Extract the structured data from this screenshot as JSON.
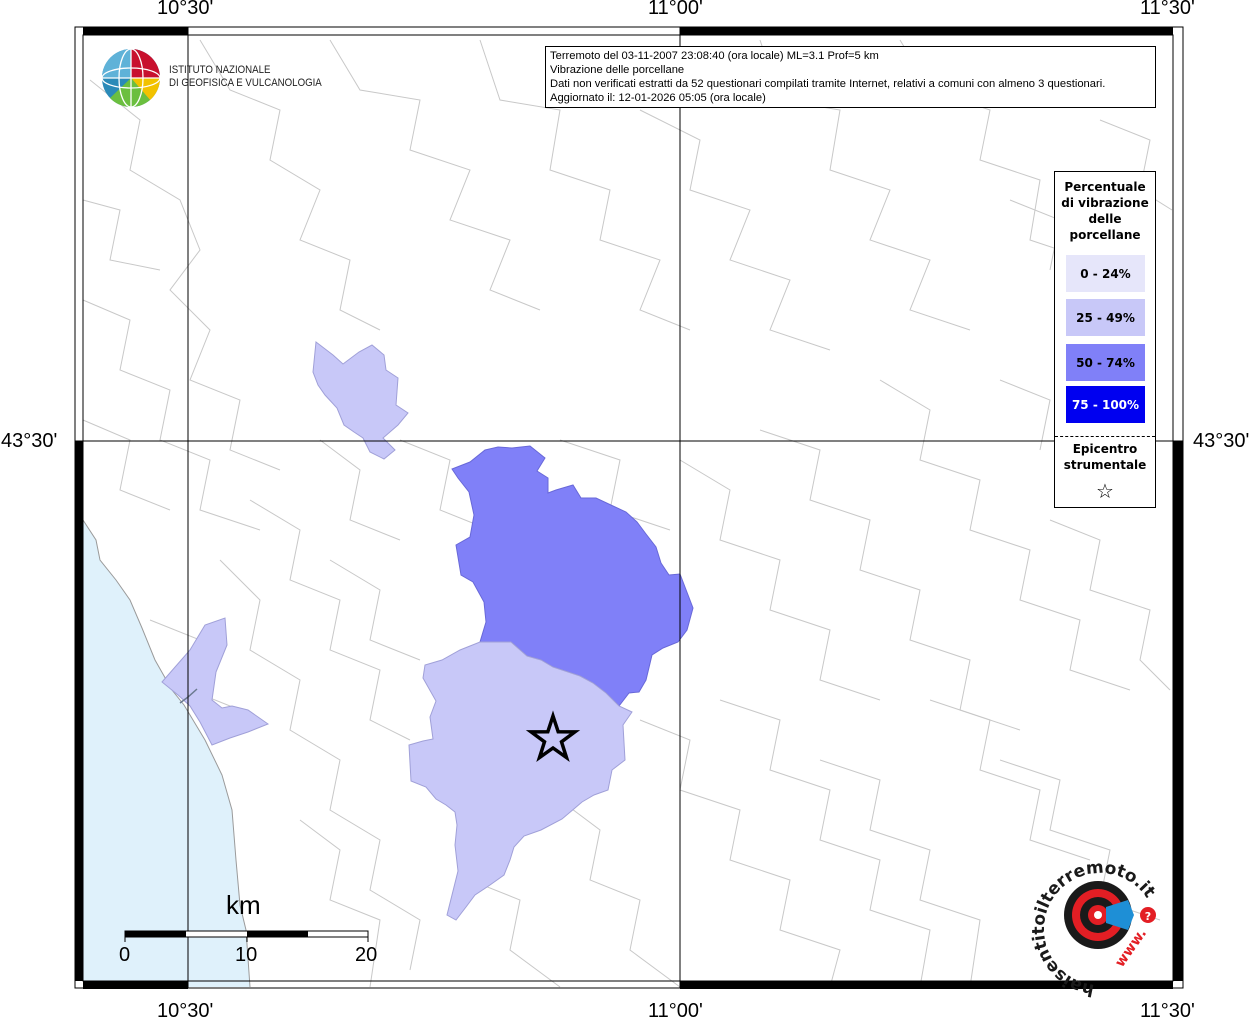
{
  "coordinates": {
    "top": [
      "10°30'",
      "11°00'",
      "11°30'"
    ],
    "bottom": [
      "10°30'",
      "11°00'",
      "11°30'"
    ],
    "left": "43°30'",
    "right": "43°30'"
  },
  "info": {
    "line1": "Terremoto del 03-11-2007 23:08:40 (ora locale) ML=3.1 Prof=5 km",
    "line2": "Vibrazione delle porcellane",
    "line3": "Dati non verificati estratti da 52 questionari compilati tramite Internet, relativi a comuni con almeno 3 questionari.",
    "line4": "Aggiornato il: 12-01-2026 05:05 (ora locale)"
  },
  "logo": {
    "line1": "ISTITUTO NAZIONALE",
    "line2": "DI GEOFISICA E VULCANOLOGIA"
  },
  "legend": {
    "title_lines": [
      "Percentuale",
      "di vibrazione",
      "delle",
      "porcellane"
    ],
    "items": [
      {
        "label": "0 - 24%",
        "color": "#e6e6fa",
        "text_color": "#000000"
      },
      {
        "label": "25 - 49%",
        "color": "#c8c8f8",
        "text_color": "#000000"
      },
      {
        "label": "50 - 74%",
        "color": "#8080f8",
        "text_color": "#000000"
      },
      {
        "label": "75 - 100%",
        "color": "#0000f0",
        "text_color": "#ffffff"
      }
    ],
    "epicenter_lines": [
      "Epicentro",
      "strumentale"
    ],
    "epicenter_symbol": "☆"
  },
  "scale": {
    "unit": "km",
    "ticks": [
      "0",
      "10",
      "20"
    ]
  },
  "stamp": {
    "ring_text": "haisentitoilterremoto.it",
    "www": "www."
  },
  "colors": {
    "sea": "#dff1fb",
    "boundary": "#c8c8c8",
    "grid": "#000000",
    "class_25_49": "#c8c8f8",
    "class_50_74": "#8080f8"
  }
}
